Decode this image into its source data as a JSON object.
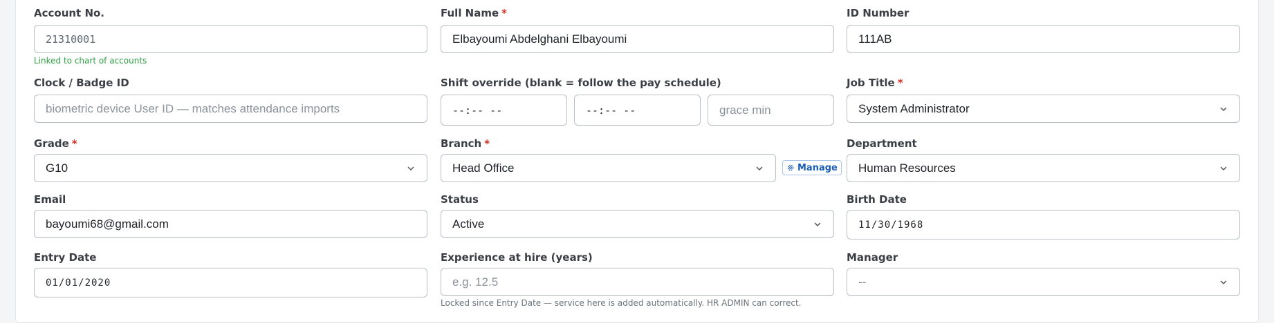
{
  "form": {
    "account_no": {
      "label": "Account No.",
      "value": "21310001",
      "help": "Linked to chart of accounts"
    },
    "full_name": {
      "label": "Full Name",
      "required": "*",
      "value": "Elbayoumi Abdelghani Elbayoumi"
    },
    "id_number": {
      "label": "ID Number",
      "value": "111AB"
    },
    "clock_badge": {
      "label": "Clock / Badge ID",
      "placeholder": "biometric device User ID — matches attendance imports"
    },
    "shift_override": {
      "label": "Shift override (blank = follow the pay schedule)",
      "start_value": "--:-- --",
      "end_value": "--:-- --",
      "grace_placeholder": "grace min"
    },
    "job_title": {
      "label": "Job Title",
      "required": "*",
      "value": "System Administrator"
    },
    "grade": {
      "label": "Grade",
      "required": "*",
      "value": "G10"
    },
    "branch": {
      "label": "Branch",
      "required": "*",
      "value": "Head Office",
      "manage_label": "Manage"
    },
    "department": {
      "label": "Department",
      "value": "Human Resources"
    },
    "email": {
      "label": "Email",
      "value": "bayoumi68@gmail.com"
    },
    "status": {
      "label": "Status",
      "value": "Active"
    },
    "birth_date": {
      "label": "Birth Date",
      "value": "11/30/1968"
    },
    "entry_date": {
      "label": "Entry Date",
      "value": "01/01/2020"
    },
    "experience": {
      "label": "Experience at hire (years)",
      "placeholder": "e.g. 12.5",
      "help": "Locked since Entry Date — service here is added automatically. HR ADMIN can correct."
    },
    "manager": {
      "label": "Manager",
      "value": "--"
    }
  },
  "icons": {
    "chevron": "chevron-down-icon",
    "gear": "gear-icon"
  },
  "colors": {
    "required": "#d93025",
    "link": "#1a5fb4",
    "success_help": "#2e9e44"
  }
}
